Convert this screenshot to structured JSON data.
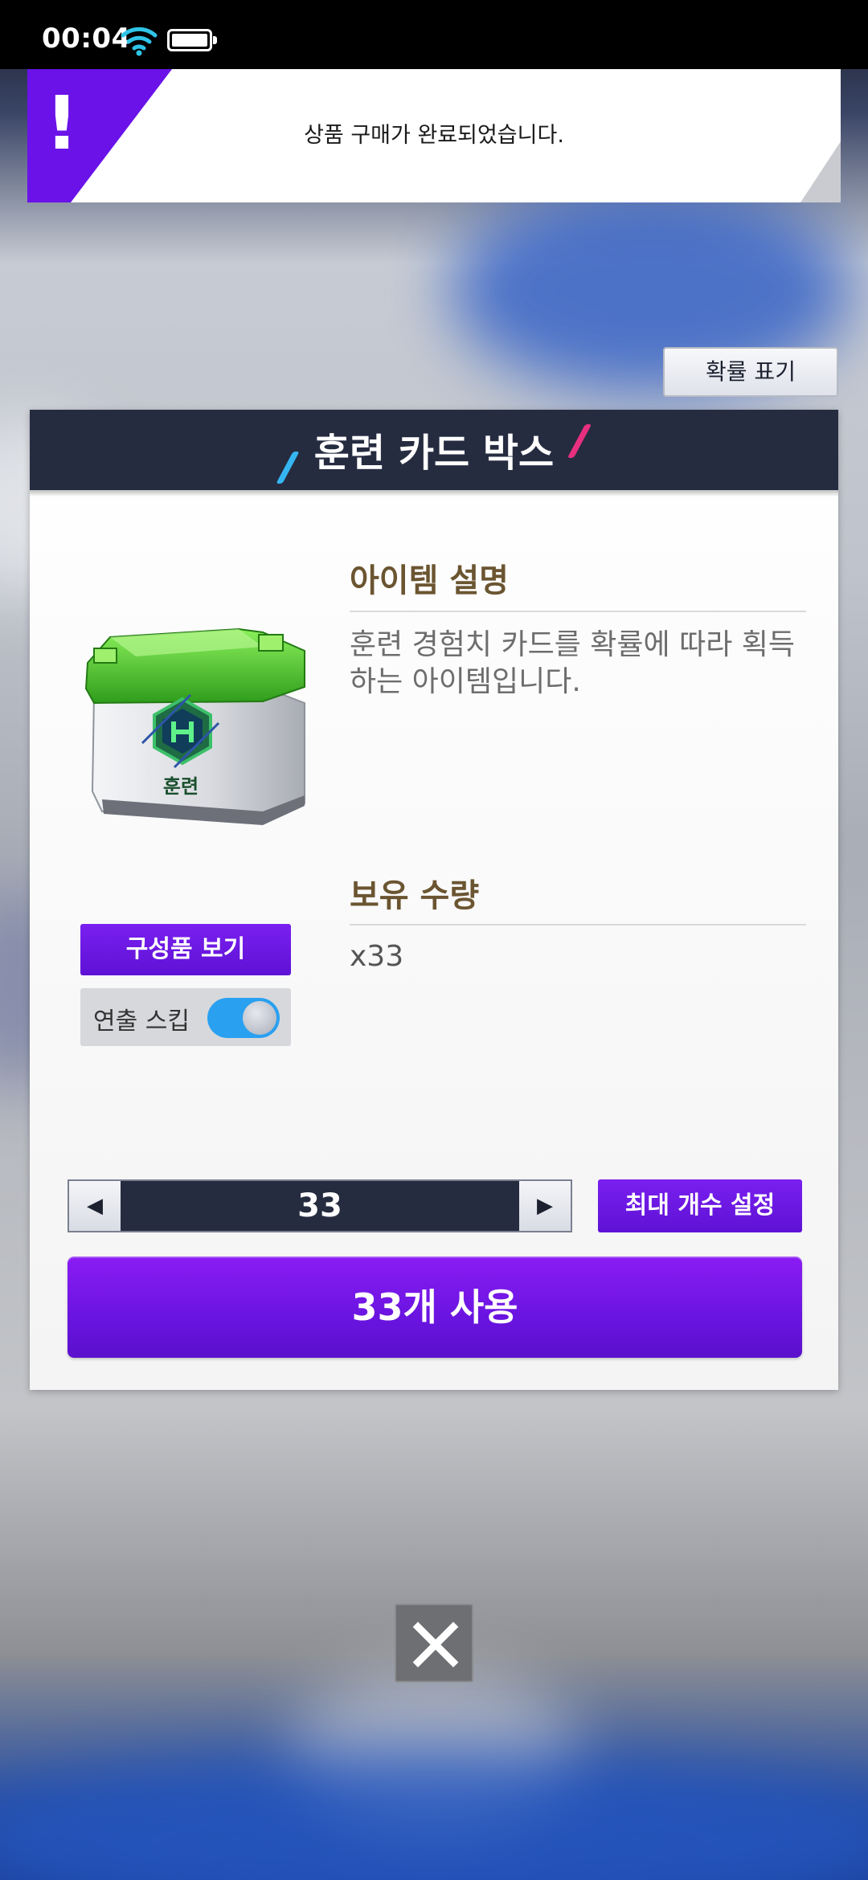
{
  "status_bar": {
    "time": "00:04"
  },
  "banner": {
    "icon": "!",
    "message": "상품 구매가 완료되었습니다."
  },
  "probability_button": {
    "label": "확률 표기"
  },
  "dialog": {
    "title": "훈련 카드 박스",
    "box_label": "훈련",
    "description_title": "아이템 설명",
    "description_text": "훈련 경험치 카드를 확률에 따라 획득하는 아이템입니다.",
    "holdings_title": "보유 수량",
    "holdings_value": "x33",
    "components_button": "구성품 보기",
    "skip_label": "연출 스킵",
    "skip_enabled": true,
    "stepper": {
      "decrease_icon": "◀",
      "value": "33",
      "increase_icon": "▶"
    },
    "max_button": "최대 개수 설정",
    "use_button": "33개 사용"
  },
  "colors": {
    "accent_purple": "#6a14e0",
    "header_navy": "#262c40",
    "toggle_blue": "#2aa0f0",
    "title_brown": "#6b5531"
  }
}
